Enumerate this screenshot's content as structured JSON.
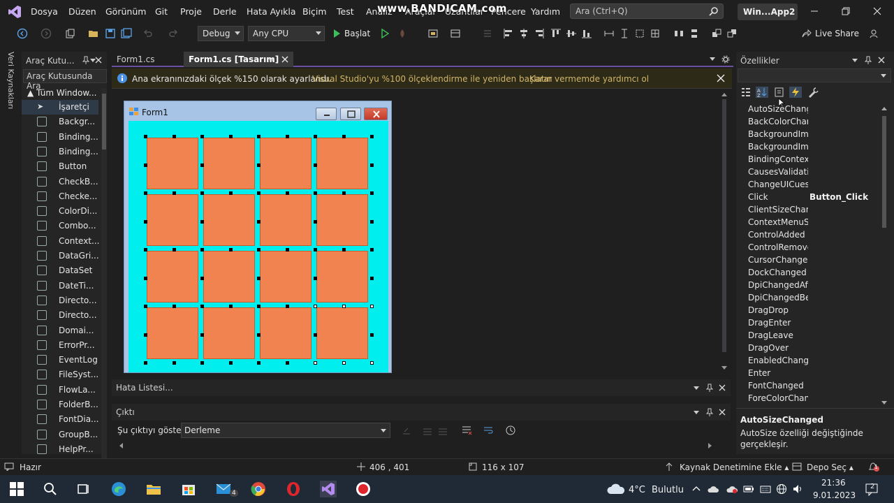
{
  "watermark": "www.BANDICAM.com",
  "menu": {
    "items": [
      "Dosya",
      "Düzen",
      "Görünüm",
      "Git",
      "Proje",
      "Derle",
      "Hata Ayıkla",
      "Biçim",
      "Test",
      "Analiz",
      "Araçlar",
      "Uzantılar",
      "Pencere",
      "Yardım"
    ],
    "search_placeholder": "Ara (Ctrl+Q)",
    "app_title": "Win...App2"
  },
  "toolbar": {
    "config": "Debug",
    "platform": "Any CPU",
    "start_label": "Başlat",
    "live_share": "Live Share"
  },
  "left_strip": {
    "label": "Veri Kaynakları"
  },
  "toolbox": {
    "title": "Araç Kutu...",
    "search_placeholder": "Araç Kutusunda Ara",
    "group": "Tüm Window...",
    "items": [
      "İşaretçi",
      "Backgr...",
      "Binding...",
      "Binding...",
      "Button",
      "CheckB...",
      "Checke...",
      "ColorDi...",
      "Combo...",
      "Context...",
      "DataGri...",
      "DataSet",
      "DateTi...",
      "Directo...",
      "Directo...",
      "Domai...",
      "ErrorPr...",
      "EventLog",
      "FileSyst...",
      "FlowLa...",
      "FolderB...",
      "FontDia...",
      "GroupB...",
      "HelpPr..."
    ]
  },
  "tabs": [
    {
      "label": "Form1.cs"
    },
    {
      "label": "Form1.cs [Tasarım]"
    }
  ],
  "infobar": {
    "message": "Ana ekranınızdaki ölçek %150 olarak ayarlandı.",
    "link1": "Visual Studio'yu %100 ölçeklendirme ile yeniden başlatın",
    "link2": "Karar vermemde yardımcı ol"
  },
  "designer": {
    "form_title": "Form1",
    "grid": {
      "rows": 4,
      "cols": 4
    }
  },
  "error_list": {
    "title": "Hata Listesi..."
  },
  "output": {
    "title": "Çıktı",
    "show_label": "Şu çıktıyı göster:",
    "source": "Derleme"
  },
  "properties": {
    "title": "Özellikler",
    "events": [
      {
        "name": "AutoSizeChanged",
        "value": ""
      },
      {
        "name": "BackColorChanged",
        "value": ""
      },
      {
        "name": "BackgroundImageChanged",
        "value": ""
      },
      {
        "name": "BackgroundImageLayoutChanged",
        "value": ""
      },
      {
        "name": "BindingContextChanged",
        "value": ""
      },
      {
        "name": "CausesValidationChanged",
        "value": ""
      },
      {
        "name": "ChangeUICues",
        "value": ""
      },
      {
        "name": "Click",
        "value": "Button_Click"
      },
      {
        "name": "ClientSizeChanged",
        "value": ""
      },
      {
        "name": "ContextMenuStripChanged",
        "value": ""
      },
      {
        "name": "ControlAdded",
        "value": ""
      },
      {
        "name": "ControlRemoved",
        "value": ""
      },
      {
        "name": "CursorChanged",
        "value": ""
      },
      {
        "name": "DockChanged",
        "value": ""
      },
      {
        "name": "DpiChangedAfterParent",
        "value": ""
      },
      {
        "name": "DpiChangedBeforeParent",
        "value": ""
      },
      {
        "name": "DragDrop",
        "value": ""
      },
      {
        "name": "DragEnter",
        "value": ""
      },
      {
        "name": "DragLeave",
        "value": ""
      },
      {
        "name": "DragOver",
        "value": ""
      },
      {
        "name": "EnabledChanged",
        "value": ""
      },
      {
        "name": "Enter",
        "value": ""
      },
      {
        "name": "FontChanged",
        "value": ""
      },
      {
        "name": "ForeColorChanged",
        "value": ""
      }
    ],
    "desc_title": "AutoSizeChanged",
    "desc_text": "AutoSize özelliği değiştiğinde gerçekleşir."
  },
  "status": {
    "state": "Hazır",
    "position": "406 , 401",
    "size": "116 x 107",
    "source_control": "Kaynak Denetimine Ekle",
    "repo": "Depo Seç",
    "notifications": "1"
  },
  "taskbar": {
    "weather_temp": "4°C",
    "weather_desc": "Bulutlu",
    "time": "21:36",
    "date": "9.01.2023",
    "mail_badge": "4",
    "notif_badge": "2"
  },
  "colors": {
    "accent": "#6b4fa0",
    "form_back": "#00eeee",
    "cell": "#f0834f",
    "infobar": "#2e2a18"
  }
}
